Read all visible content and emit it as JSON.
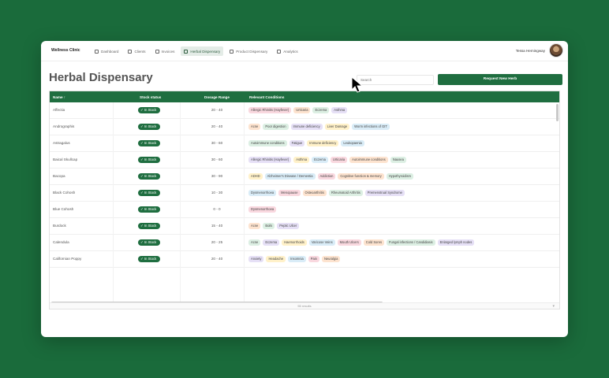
{
  "app": {
    "brand": "Wellness Clinic"
  },
  "nav": [
    {
      "label": "Dashboard",
      "icon": "dashboard-icon",
      "active": false
    },
    {
      "label": "Clients",
      "icon": "users-icon",
      "active": false
    },
    {
      "label": "Invoices",
      "icon": "invoice-icon",
      "active": false
    },
    {
      "label": "Herbal Dispensary",
      "icon": "herb-icon",
      "active": true
    },
    {
      "label": "Product Dispensary",
      "icon": "product-icon",
      "active": false
    },
    {
      "label": "Analytics",
      "icon": "analytics-icon",
      "active": false
    }
  ],
  "user": {
    "name": "Tessa Hemingway"
  },
  "page": {
    "title": "Herbal Dispensary",
    "search_placeholder": "Search",
    "request_button": "Request New Herb"
  },
  "table": {
    "columns": {
      "name": "Name ↑",
      "status": "Stock status",
      "dosage": "Dosage Range",
      "conditions": "Relevant Conditions"
    },
    "rows": [
      {
        "name": "Affectia",
        "status": "✓ In Stock",
        "dosage": "20 - 40",
        "tags": [
          "Allergic Rhinitis (Hayfever)",
          "Urticaria",
          "Eczema",
          "Asthma"
        ]
      },
      {
        "name": "Andrographis",
        "status": "✓ In Stock",
        "dosage": "20 - 40",
        "tags": [
          "Acne",
          "Poor digestion",
          "Immune deficiency",
          "Liver Damage",
          "Worm infections of GIT"
        ]
      },
      {
        "name": "Astragalus",
        "status": "✓ In Stock",
        "dosage": "30 - 60",
        "tags": [
          "Autoimmune conditions",
          "Fatigue",
          "Immune deficiency",
          "Leukopaenia"
        ]
      },
      {
        "name": "Baical Skullcap",
        "status": "✓ In Stock",
        "dosage": "30 - 60",
        "tags": [
          "Allergic Rhinitis (Hayfever)",
          "Asthma",
          "Eczema",
          "Urticaria",
          "Autoimmune conditions",
          "Nausea"
        ]
      },
      {
        "name": "Bacopa",
        "status": "✓ In Stock",
        "dosage": "30 - 90",
        "tags": [
          "ADHD",
          "Alzheimer's Disease / Dementia",
          "Addiction",
          "Cognitive function & memory",
          "Hypothyroidism"
        ]
      },
      {
        "name": "Black Cohosh",
        "status": "✓ In Stock",
        "dosage": "10 - 30",
        "tags": [
          "Dysmenorrhoea",
          "Menopause",
          "Osteoarthritis",
          "Rheumatoid Arthritis",
          "Premenstrual Syndrome"
        ]
      },
      {
        "name": "Blue Cohosh",
        "status": "✓ In Stock",
        "dosage": "0 - 0",
        "tags": [
          "Dysmenorrhoea"
        ]
      },
      {
        "name": "Burdock",
        "status": "✓ In Stock",
        "dosage": "15 - 40",
        "tags": [
          "Acne",
          "Boils",
          "Peptic Ulcer"
        ]
      },
      {
        "name": "Calendula",
        "status": "✓ In Stock",
        "dosage": "20 - 25",
        "tags": [
          "Acne",
          "Eczema",
          "Haemorrhoids",
          "Varicose Veins",
          "Mouth Ulcers",
          "Cold Sores",
          "Fungal infections / Candidiasis",
          "Enlarged lymph nodes"
        ]
      },
      {
        "name": "Californian Poppy",
        "status": "✓ In Stock",
        "dosage": "20 - 40",
        "tags": [
          "Anxiety",
          "Headache",
          "Insomnia",
          "Pain",
          "Neuralgia"
        ]
      }
    ],
    "footer": "55 results"
  },
  "colors": {
    "accent": "#1f6e40",
    "background": "#1a6b3b"
  }
}
